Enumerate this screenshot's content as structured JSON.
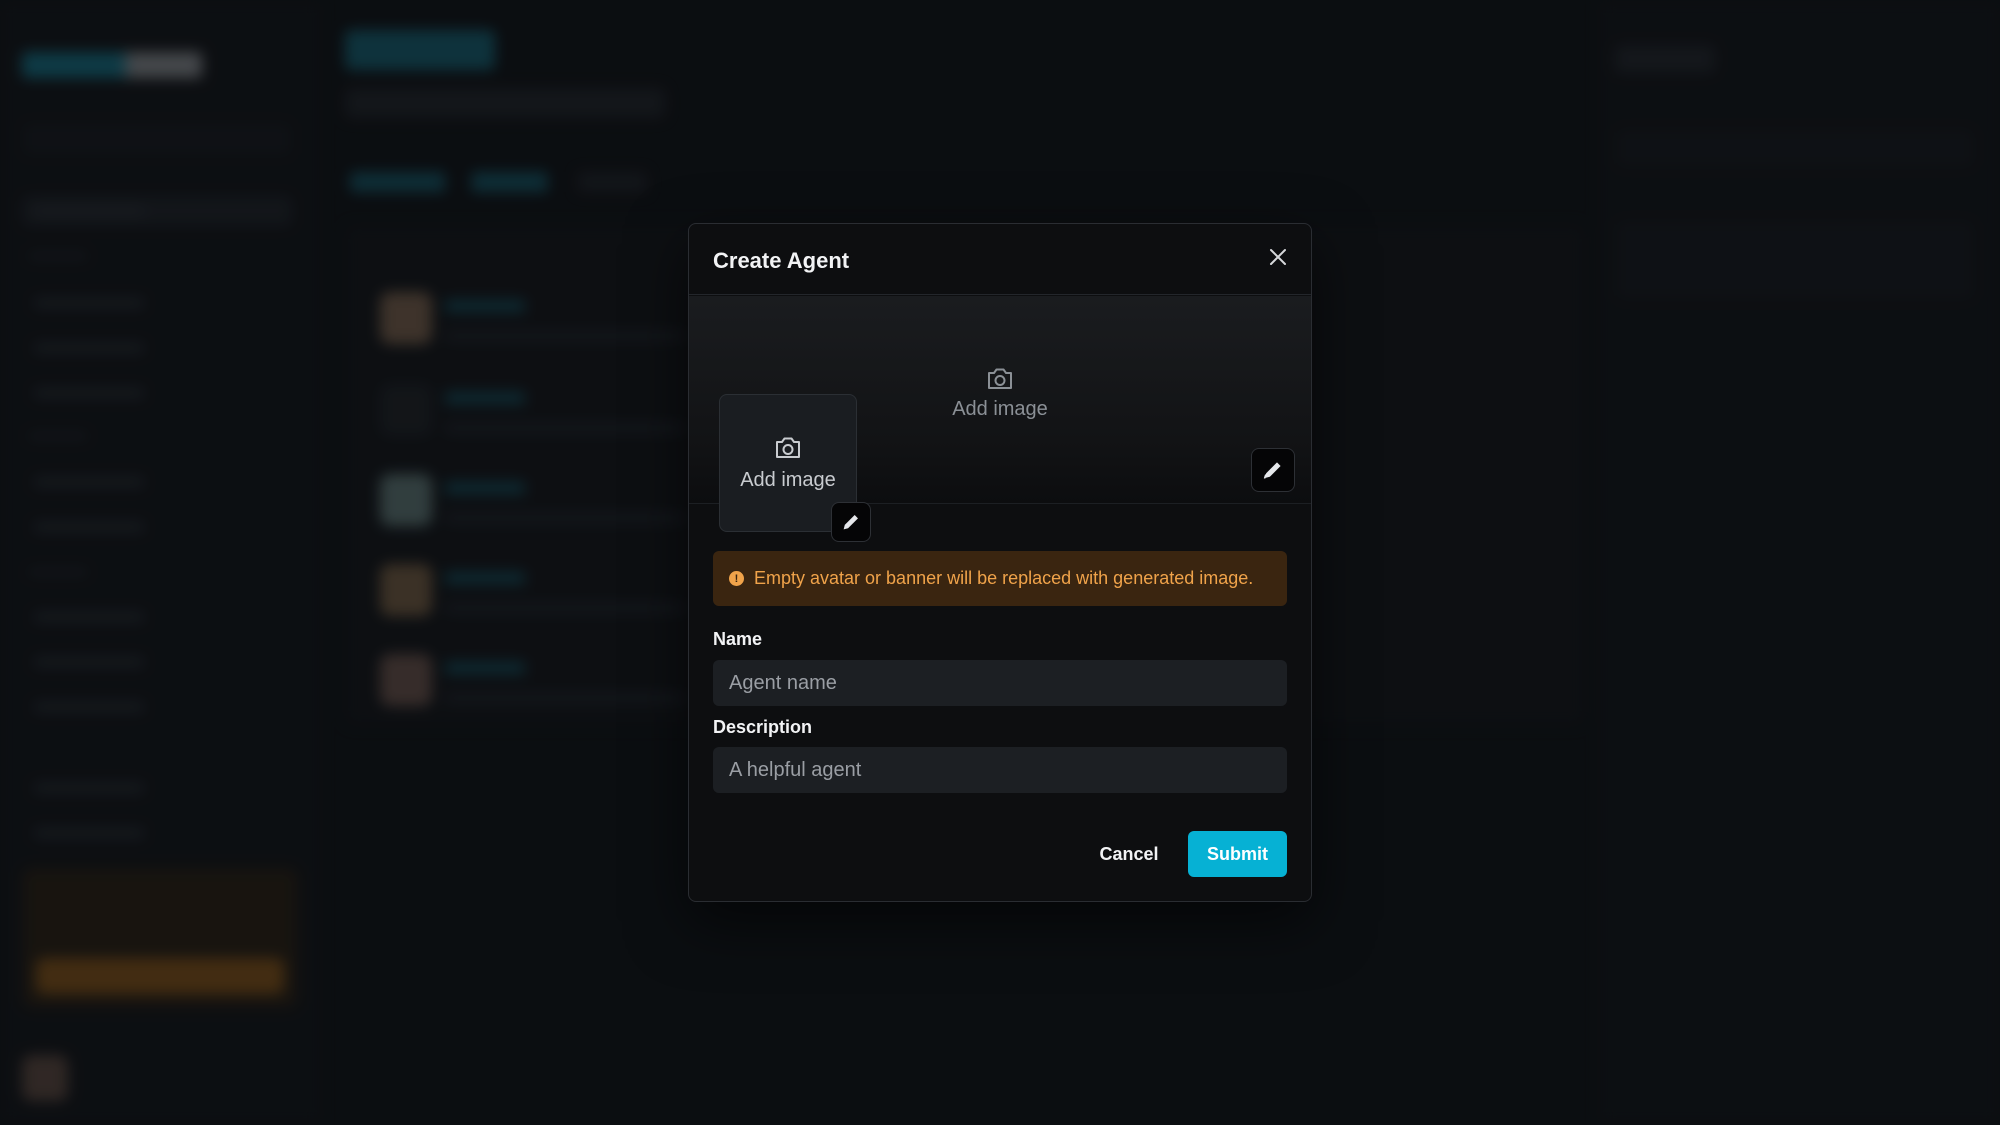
{
  "modal": {
    "title": "Create Agent",
    "banner": {
      "add_label": "Add image"
    },
    "avatar": {
      "add_label": "Add image"
    },
    "notice": "Empty avatar or banner will be replaced with generated image.",
    "name_field": {
      "label": "Name",
      "placeholder": "Agent name",
      "value": ""
    },
    "description_field": {
      "label": "Description",
      "placeholder": "A helpful agent",
      "value": ""
    },
    "cancel_label": "Cancel",
    "submit_label": "Submit"
  },
  "icons": {
    "close": "close-icon",
    "camera": "camera-icon",
    "edit": "pencil-icon",
    "info": "info-icon"
  },
  "colors": {
    "accent": "#06b1d4",
    "notice_bg": "#3a2510",
    "notice_text": "#f0a34a",
    "modal_bg": "#0d0e10"
  }
}
